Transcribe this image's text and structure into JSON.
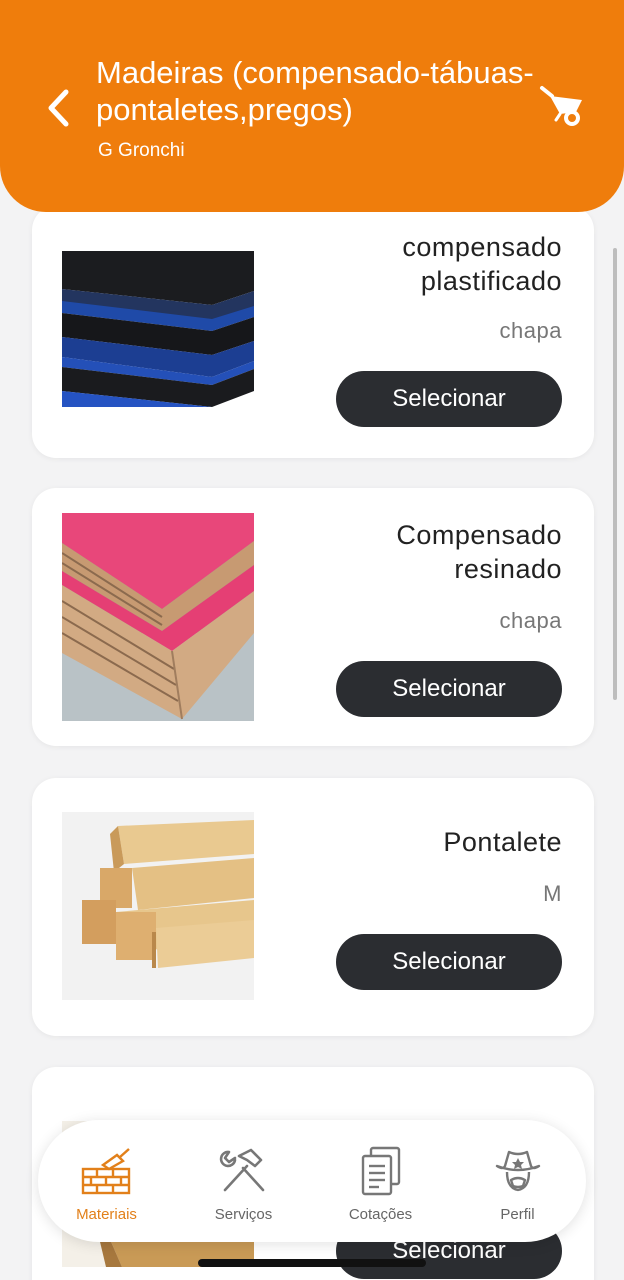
{
  "header": {
    "title": "Madeiras (compensado-tábuas-pontaletes,pregos)",
    "subtitle": "G Gronchi",
    "back_icon": "chevron-left-icon",
    "cart_icon": "wheelbarrow-icon",
    "background": "#ef7d0c"
  },
  "products": [
    {
      "name": "compensado plastificado",
      "unit": "chapa",
      "button": "Selecionar",
      "image": "black plywood sheets with blue edges"
    },
    {
      "name": "Compensado resinado",
      "unit": "chapa",
      "button": "Selecionar",
      "image": "pink resined plywood sheets"
    },
    {
      "name": "Pontalete",
      "unit": "M",
      "button": "Selecionar",
      "image": "stacked wooden beams"
    },
    {
      "name": "",
      "unit": "",
      "button": "Selecionar",
      "image": "wooden board"
    }
  ],
  "nav": {
    "items": [
      {
        "label": "Materiais",
        "icon": "brick-wall-trowel-icon",
        "active": true
      },
      {
        "label": "Serviços",
        "icon": "hammer-wrench-icon",
        "active": false
      },
      {
        "label": "Cotações",
        "icon": "documents-icon",
        "active": false
      },
      {
        "label": "Perfil",
        "icon": "cowboy-avatar-icon",
        "active": false
      }
    ],
    "active_color": "#e2801a"
  },
  "colors": {
    "button_bg": "#2b2d31",
    "page_bg": "#f3f3f4"
  }
}
